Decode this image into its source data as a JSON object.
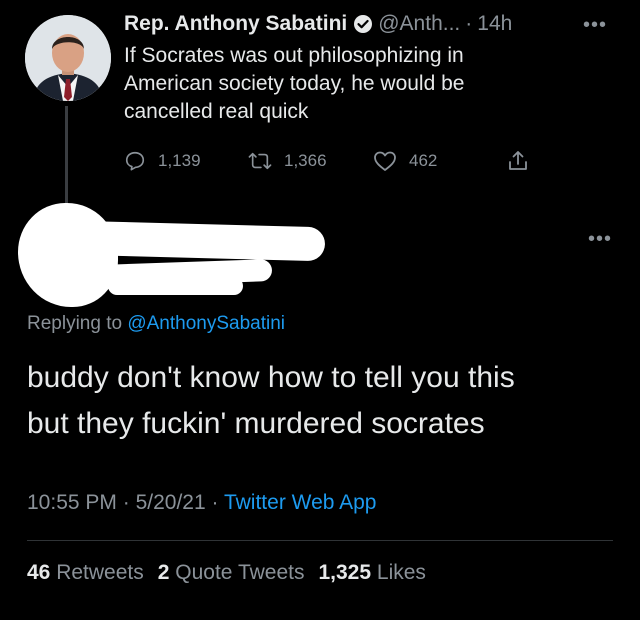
{
  "tweet": {
    "author_name": "Rep. Anthony Sabatini",
    "handle": "@Anth...",
    "separator": "·",
    "time": "14h",
    "body_lines": [
      "If Socrates was out philosophizing in",
      "American society today, he would be",
      "cancelled real quick"
    ],
    "actions": {
      "reply_count": "1,139",
      "retweet_count": "1,366",
      "like_count": "462"
    }
  },
  "reply": {
    "replying_prefix": "Replying to",
    "replying_handle": "@AnthonySabatini",
    "body_lines": [
      "buddy don't know how to tell you this",
      "but they fuckin' murdered socrates"
    ],
    "meta": {
      "time": "10:55 PM",
      "date": "5/20/21",
      "separator": "·",
      "source": "Twitter Web App"
    },
    "stats": {
      "retweets_count": "46",
      "retweets_label": "Retweets",
      "quote_count": "2",
      "quote_label": "Quote Tweets",
      "likes_count": "1,325",
      "likes_label": "Likes"
    }
  },
  "colors": {
    "background": "#000000",
    "text": "#e7e9ea",
    "muted": "#8b9299",
    "link": "#1d9bf0"
  }
}
